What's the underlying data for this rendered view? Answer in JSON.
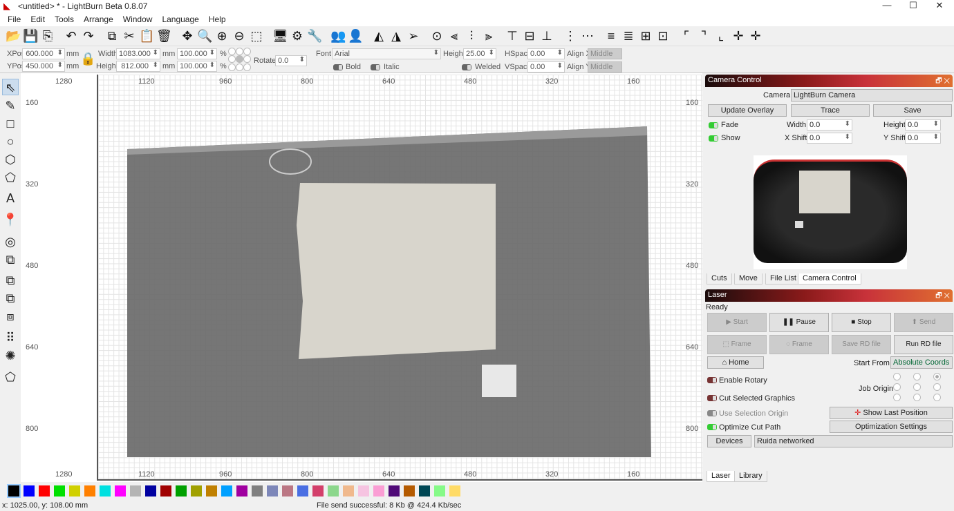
{
  "window": {
    "title": "<untitled> * - LightBurn Beta 0.8.07",
    "minimize": "—",
    "maximize": "☐",
    "close": "✕"
  },
  "menu": [
    "File",
    "Edit",
    "Tools",
    "Arrange",
    "Window",
    "Language",
    "Help"
  ],
  "toolbar": [
    {
      "name": "open-icon",
      "g": "📂"
    },
    {
      "name": "save-icon",
      "g": "💾"
    },
    {
      "name": "import-icon",
      "g": "⎘"
    },
    {
      "sep": true
    },
    {
      "name": "undo-icon",
      "g": "↶"
    },
    {
      "name": "redo-icon",
      "g": "↷"
    },
    {
      "sep": true
    },
    {
      "name": "copy-icon",
      "g": "⧉"
    },
    {
      "name": "cut-icon",
      "g": "✂"
    },
    {
      "name": "paste-icon",
      "g": "📋"
    },
    {
      "name": "delete-icon",
      "g": "🗑"
    },
    {
      "sep": true
    },
    {
      "name": "move-icon",
      "g": "✥"
    },
    {
      "name": "zoom-icon",
      "g": "🔍"
    },
    {
      "name": "zoom-in-icon",
      "g": "⊕"
    },
    {
      "name": "zoom-out-icon",
      "g": "⊖"
    },
    {
      "name": "zoom-frame-icon",
      "g": "⬚"
    },
    {
      "sep": true
    },
    {
      "name": "monitor-icon",
      "g": "🖥"
    },
    {
      "name": "settings-icon",
      "g": "⚙"
    },
    {
      "name": "tools-icon",
      "g": "🔧"
    },
    {
      "sep": true
    },
    {
      "name": "group-icon",
      "g": "👥"
    },
    {
      "name": "ungroup-icon",
      "g": "👤"
    },
    {
      "sep": true
    },
    {
      "name": "flip-h-icon",
      "g": "◭"
    },
    {
      "name": "mirror-icon",
      "g": "◮"
    },
    {
      "name": "send-icon",
      "g": "➢"
    },
    {
      "sep": true
    },
    {
      "name": "target-icon",
      "g": "⊙"
    },
    {
      "name": "align-left-icon",
      "g": "⫷"
    },
    {
      "name": "align-center-icon",
      "g": "⫶"
    },
    {
      "name": "align-right-icon",
      "g": "⫸"
    },
    {
      "sep": true
    },
    {
      "name": "align-top-icon",
      "g": "⊤"
    },
    {
      "name": "align-middle-icon",
      "g": "⊟"
    },
    {
      "name": "align-bottom-icon",
      "g": "⊥"
    },
    {
      "sep": true
    },
    {
      "name": "distribute-h-icon",
      "g": "⋮"
    },
    {
      "name": "distribute-v-icon",
      "g": "⋯"
    },
    {
      "sep": true
    },
    {
      "name": "space-h-icon",
      "g": "≡"
    },
    {
      "name": "space-v-icon",
      "g": "≣"
    },
    {
      "name": "center-icon",
      "g": "⊞"
    },
    {
      "name": "width-icon",
      "g": "⊡"
    },
    {
      "sep": true
    },
    {
      "name": "corner-tl-icon",
      "g": "⌜"
    },
    {
      "name": "corner-tr-icon",
      "g": "⌝"
    },
    {
      "name": "corner-bl-icon",
      "g": "⌞"
    },
    {
      "name": "crosshair-icon",
      "g": "✛"
    },
    {
      "name": "crosshair2-icon",
      "g": "✛"
    }
  ],
  "props": {
    "xpos_label": "XPos",
    "xpos": "600.000",
    "ypos_label": "YPos",
    "ypos": "450.000",
    "unit": "mm",
    "width_label": "Width",
    "width": "1083.000",
    "height_label": "Height",
    "height": "812.000",
    "scale_w": "100.000",
    "scale_h": "100.000",
    "pct": "%",
    "rotate_label": "Rotate",
    "rotate": "0.0",
    "font_label": "Font",
    "font": "Arial",
    "font_height_label": "Height",
    "font_height": "25.00",
    "hspace_label": "HSpace",
    "hspace": "0.00",
    "vspace_label": "VSpace",
    "vspace": "0.00",
    "alignx_label": "Align X",
    "alignx": "Middle",
    "aligny_label": "Align Y",
    "aligny": "Middle",
    "bold": "Bold",
    "italic": "Italic",
    "welded": "Welded"
  },
  "lefttools": [
    "select-icon",
    "pen-icon",
    "rectangle-icon",
    "ellipse-icon",
    "polygon-icon",
    "polygon2-icon",
    "text-icon",
    "position-icon",
    "offset-icon",
    "weld-icon",
    "union-icon",
    "subtract-icon",
    "intersect-icon",
    "array-icon",
    "circular-array-icon",
    "tabs-icon"
  ],
  "lefttool_glyphs": [
    "⇖",
    "✎",
    "□",
    "○",
    "⬡",
    "⬠",
    "A",
    "📍",
    "◎",
    "⧉",
    "⧉",
    "⧉",
    "⧈",
    "⠿",
    "✺",
    "⬠"
  ],
  "ruler": {
    "x": [
      "1280",
      "1120",
      "960",
      "800",
      "640",
      "480",
      "320",
      "160"
    ],
    "y": [
      "160",
      "320",
      "480",
      "640",
      "800"
    ]
  },
  "camera": {
    "title": "Camera Control",
    "camera_label": "Camera:",
    "camera": "LightBurn Camera",
    "update_overlay": "Update Overlay",
    "trace": "Trace",
    "save": "Save",
    "fade": "Fade",
    "show": "Show",
    "width_label": "Width",
    "width": "0.0",
    "height_label": "Height",
    "height": "0.0",
    "xshift_label": "X Shift",
    "xshift": "0.0",
    "yshift_label": "Y Shift",
    "yshift": "0.0"
  },
  "tabs": [
    "Cuts",
    "Move",
    "File List",
    "Camera Control"
  ],
  "laser": {
    "title": "Laser",
    "status": "Ready",
    "start": "Start",
    "pause": "Pause",
    "stop": "Stop",
    "send": "Send",
    "frame1": "Frame",
    "frame2": "Frame",
    "save_rd": "Save RD file",
    "run_rd": "Run RD file",
    "home": "Home",
    "start_from_label": "Start From:",
    "start_from": "Absolute Coords",
    "job_origin": "Job Origin",
    "enable_rotary": "Enable Rotary",
    "cut_selected": "Cut Selected Graphics",
    "use_selection_origin": "Use Selection Origin",
    "optimize": "Optimize Cut Path",
    "show_last": "Show Last Position",
    "opt_settings": "Optimization Settings",
    "devices": "Devices",
    "device": "Ruida networked"
  },
  "bottom_tabs": [
    "Laser",
    "Library"
  ],
  "palette": [
    "#000000",
    "#0000ff",
    "#ff0000",
    "#00e000",
    "#d0d000",
    "#ff8000",
    "#00e0e0",
    "#ff00ff",
    "#b4b4b4",
    "#0000a0",
    "#a00000",
    "#00a000",
    "#a0a000",
    "#c08000",
    "#00a0ff",
    "#a000a0",
    "#808080",
    "#7d87b9",
    "#bb7784",
    "#4a6fe3",
    "#d33f6a",
    "#8cd78c",
    "#f0b98d",
    "#f6c4e1",
    "#fa9ed4",
    "#500a78",
    "#b45a00",
    "#004754",
    "#86fa88",
    "#ffdb66"
  ],
  "status": {
    "coords": "x: 1025.00, y: 108.00 mm",
    "message": "File send successful: 8 Kb @ 424.4 Kb/sec"
  }
}
